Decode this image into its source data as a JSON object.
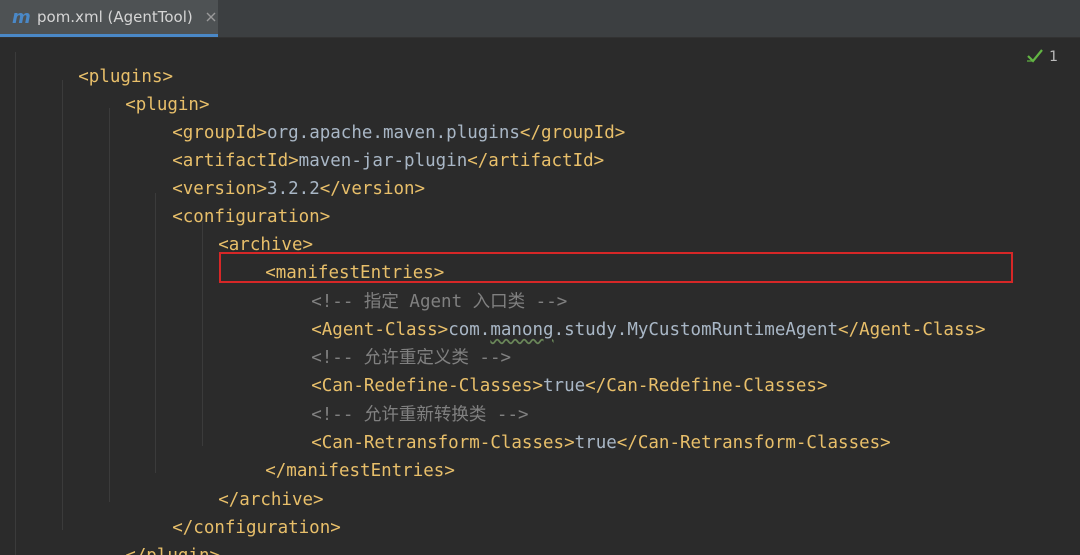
{
  "tab": {
    "file_name": "pom.xml (AgentTool)",
    "icon": "maven-m-icon",
    "close_icon": "close-icon"
  },
  "inspection": {
    "icon": "check-icon",
    "count": "1"
  },
  "colors": {
    "tag": "#e8bf6a",
    "text": "#a9b7c6",
    "comment": "#808080",
    "highlight": "#d62727",
    "accent": "#4a88c7",
    "maven_icon": "#4a88c7",
    "inspection_ok": "#62b543"
  },
  "code": {
    "l1": {
      "open": "<plugins>"
    },
    "l2": {
      "open": "<plugin>"
    },
    "l3": {
      "open": "<groupId>",
      "value": "org.apache.maven.plugins",
      "close": "</groupId>"
    },
    "l4": {
      "open": "<artifactId>",
      "value": "maven-jar-plugin",
      "close": "</artifactId>"
    },
    "l5": {
      "open": "<version>",
      "value": "3.2.2",
      "close": "</version>"
    },
    "l6": {
      "open": "<configuration>"
    },
    "l7": {
      "open": "<archive>"
    },
    "l8": {
      "open_first": "<",
      "open_rest": "manifestEntries>"
    },
    "l9": {
      "comment": "<!-- 指定 Agent 入口类 -->"
    },
    "l10": {
      "open": "<Agent-Class>",
      "value_a": "com.",
      "value_b": "manong",
      "value_c": ".study.MyCustomRuntimeAgent",
      "close": "</Agent-Class>"
    },
    "l11": {
      "comment": "<!-- 允许重定义类 -->"
    },
    "l12": {
      "open": "<Can-Redefine-Classes>",
      "value": "true",
      "close": "</Can-Redefine-Classes>"
    },
    "l13": {
      "comment": "<!-- 允许重新转换类 -->"
    },
    "l14": {
      "open": "<Can-Retransform-Classes>",
      "value": "true",
      "close": "</Can-Retransform-Classes>"
    },
    "l15": {
      "close": "</manifestEntries>"
    },
    "l16": {
      "close": "</archive>"
    },
    "l17": {
      "close": "</configuration>"
    },
    "l18": {
      "close": "</plugin>"
    }
  }
}
